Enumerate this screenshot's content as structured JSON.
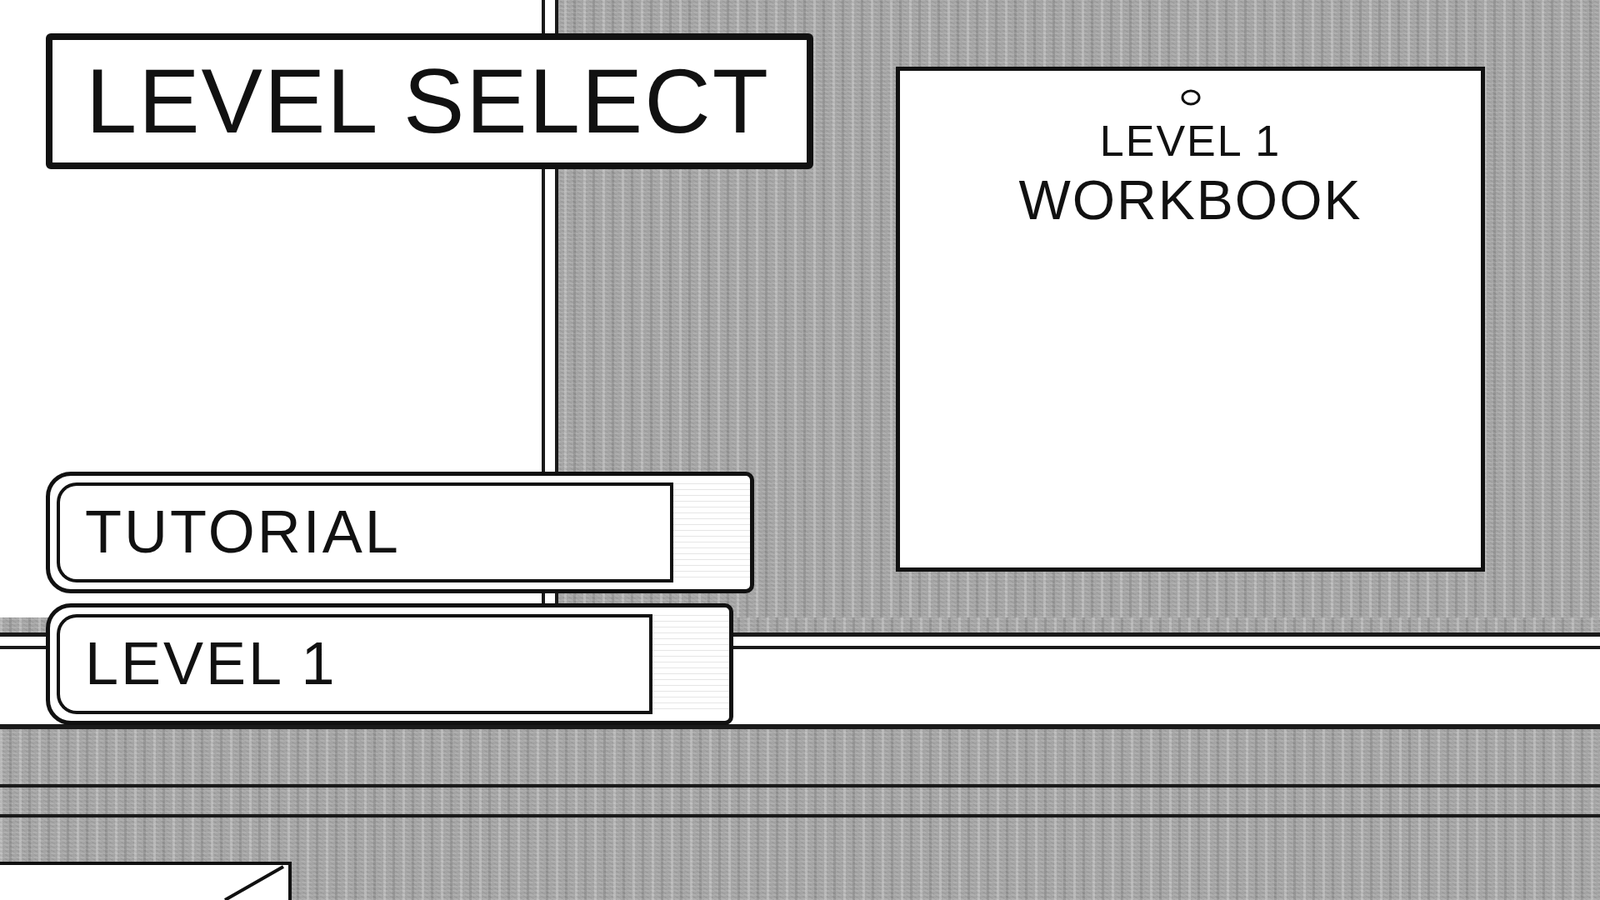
{
  "title": "LEVEL SELECT",
  "books": [
    {
      "label": "TUTORIAL"
    },
    {
      "label": "LEVEL 1"
    }
  ],
  "workbook": {
    "subtitle": "LEVEL 1",
    "title": "WORKBOOK"
  }
}
